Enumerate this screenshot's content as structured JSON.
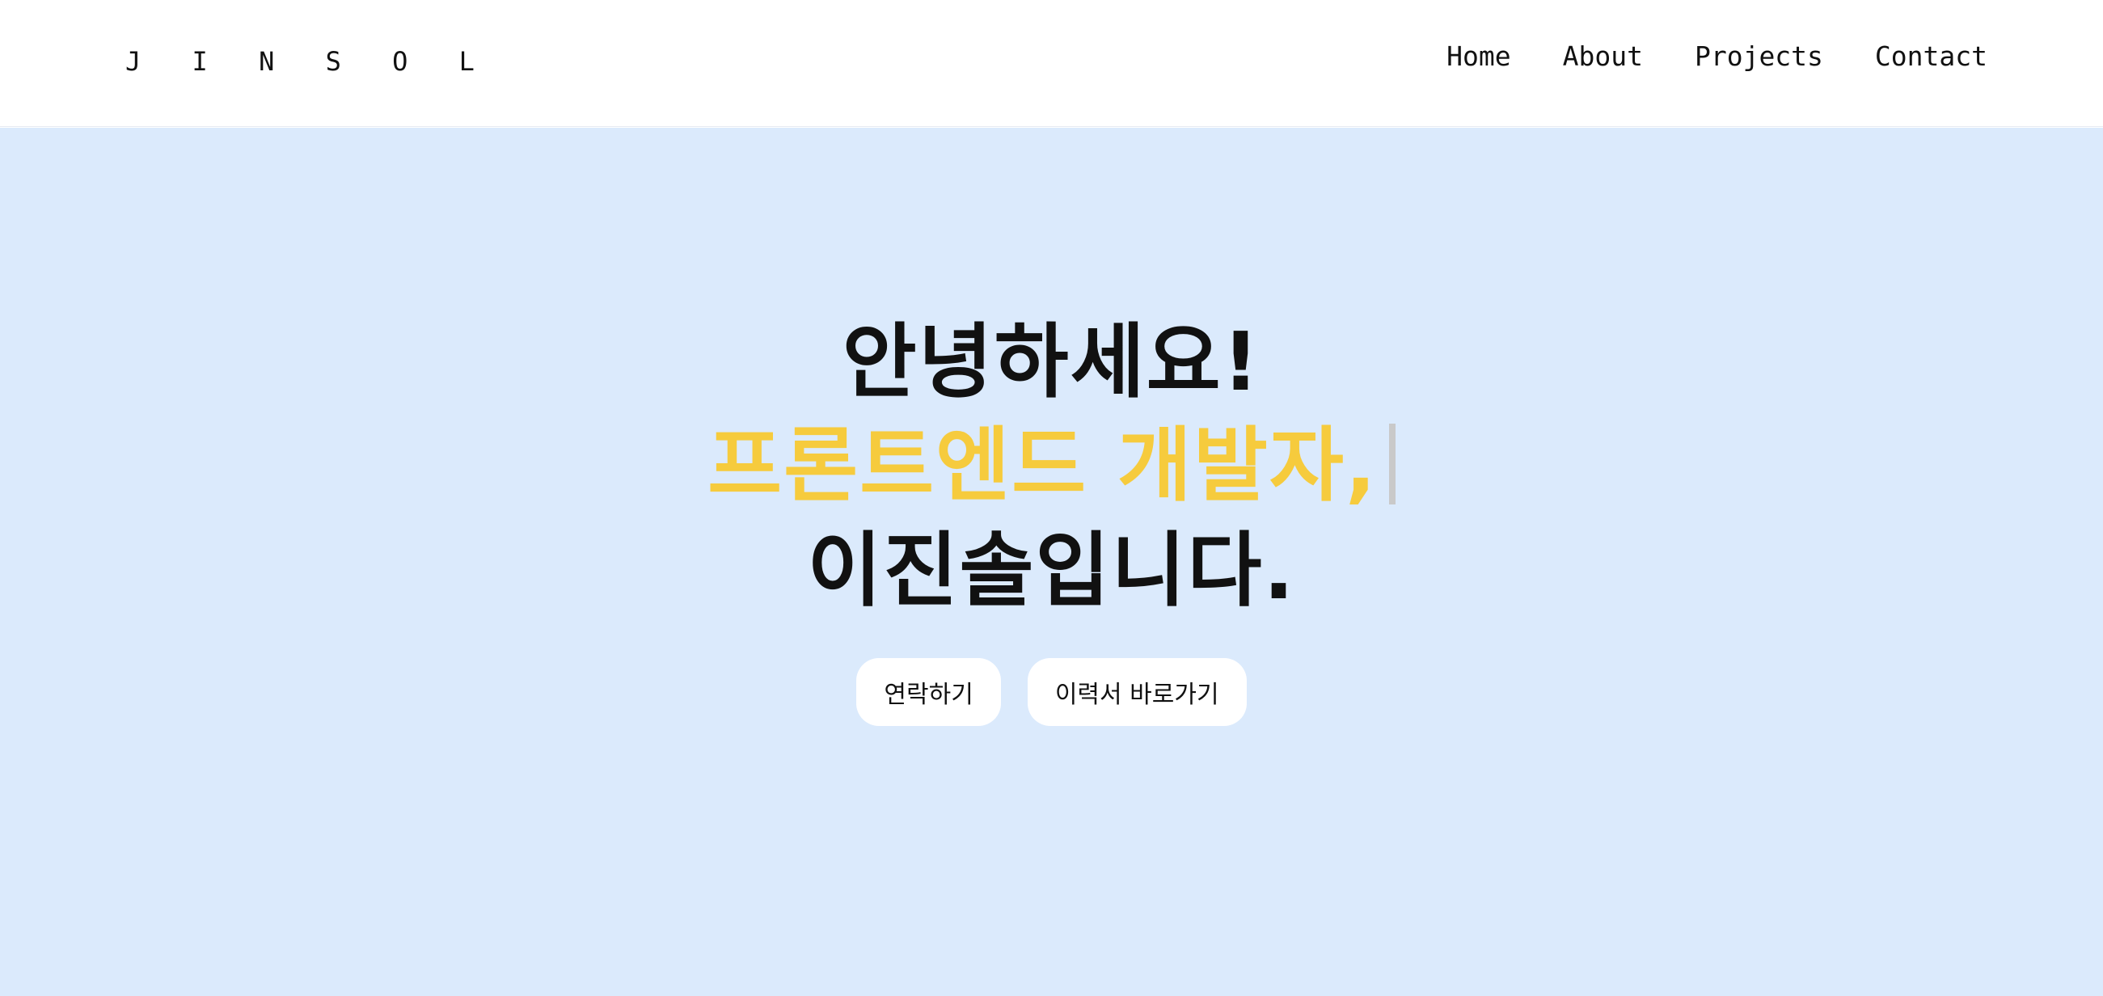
{
  "header": {
    "logo": "J I N S O L",
    "nav": [
      {
        "label": "Home"
      },
      {
        "label": "About"
      },
      {
        "label": "Projects"
      },
      {
        "label": "Contact"
      }
    ]
  },
  "hero": {
    "line1": "안녕하세요!",
    "line2": "프론트엔드 개발자,",
    "line3": "이진솔입니다.",
    "buttons": {
      "contact_label": "연락하기",
      "resume_label": "이력서 바로가기"
    }
  },
  "colors": {
    "hero_background": "#dbeafc",
    "accent": "#f6cb3d",
    "text": "#111111",
    "button_background": "#ffffff"
  }
}
